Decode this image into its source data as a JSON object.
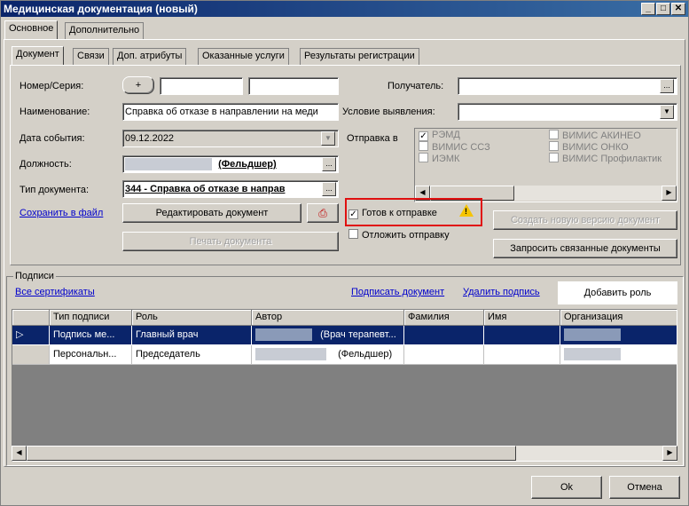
{
  "window": {
    "title": "Медицинская документация (новый)",
    "minimize": "_",
    "maximize": "□",
    "close": "✕"
  },
  "top_tabs": [
    "Основное",
    "Дополнительно"
  ],
  "doc_tabs": [
    "Документ",
    "Связи",
    "Доп. атрибуты",
    "Оказанные услуги",
    "Результаты регистрации"
  ],
  "form": {
    "number_label": "Номер/Серия:",
    "plus_label": "+",
    "name_label": "Наименование:",
    "name_value": "Справка об отказе в направлении на меди",
    "date_label": "Дата события:",
    "date_value": "09.12.2022",
    "position_label": "Должность:",
    "position_value": "(Фельдшер)",
    "doctype_label": "Тип документа:",
    "doctype_value": "344 - Справка об отказе в направ",
    "recipient_label": "Получатель:",
    "condition_label": "Условие выявления:",
    "send_label": "Отправка в",
    "ellipsis": "..."
  },
  "send_targets": {
    "col1": [
      {
        "label": "РЭМД",
        "checked": true
      },
      {
        "label": "ВИМИС ССЗ",
        "checked": false
      },
      {
        "label": "ИЭМК",
        "checked": false
      }
    ],
    "col2": [
      {
        "label": "ВИМИС АКИНЕО",
        "checked": false
      },
      {
        "label": "ВИМИС ОНКО",
        "checked": false
      },
      {
        "label": "ВИМИС Профилактик",
        "checked": false
      }
    ]
  },
  "actions": {
    "save_file": "Сохранить в файл",
    "edit_doc": "Редактировать документ",
    "print_doc": "Печать документа",
    "ready_to_send": "Готов к отправке",
    "ready_checked": true,
    "postpone": "Отложить отправку",
    "postpone_checked": false,
    "new_version": "Создать новую версию документ",
    "request_related": "Запросить связанные документы"
  },
  "signatures": {
    "group_label": "Подписи",
    "all_certs": "Все сертификаты",
    "sign_doc": "Подписать документ",
    "delete_sig": "Удалить подпись",
    "add_role": "Добавить роль",
    "columns": [
      "Тип подписи",
      "Роль",
      "Автор",
      "Фамилия",
      "Имя",
      "Организация"
    ],
    "rows": [
      {
        "type": "Подпись ме...",
        "role": "Главный врач",
        "author": "(Врач терапевт...",
        "last": "",
        "first": "",
        "org": ""
      },
      {
        "type": "Персональн...",
        "role": "Председатель",
        "author": "(Фельдшер)",
        "last": "",
        "first": "",
        "org": ""
      }
    ]
  },
  "footer": {
    "ok": "Ok",
    "cancel": "Отмена"
  }
}
